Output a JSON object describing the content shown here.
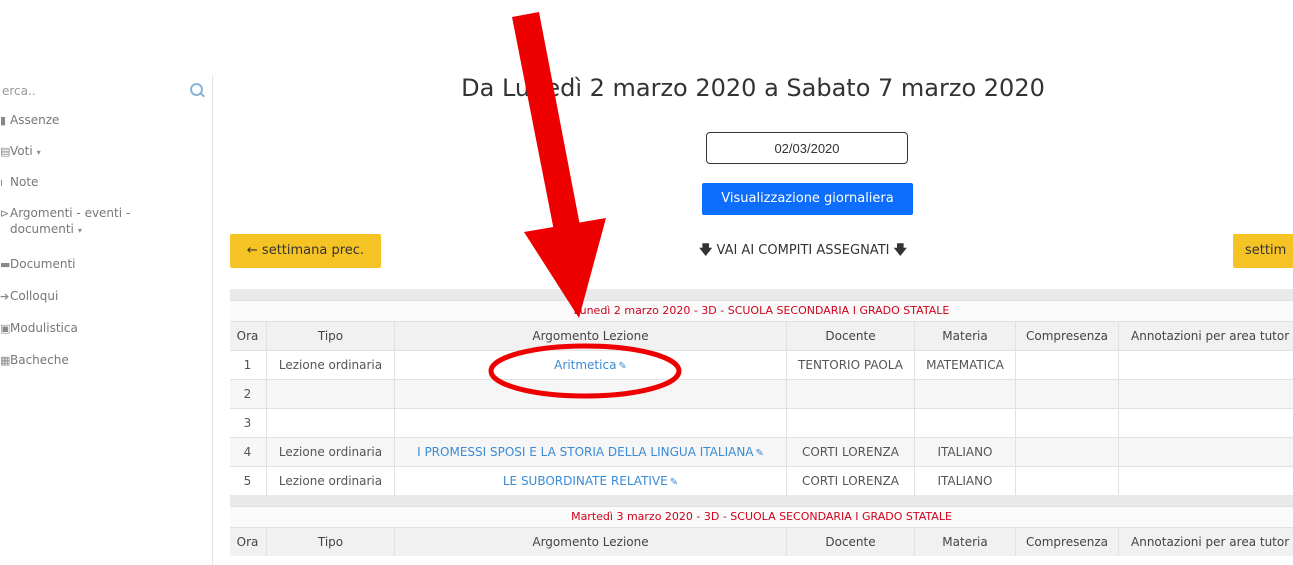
{
  "sidebar": {
    "search_placeholder": "erca..",
    "items": [
      {
        "label": "Assenze",
        "icon": "calendar-icon",
        "glyph": "▮"
      },
      {
        "label": "Voti",
        "icon": "grades-icon",
        "glyph": "▤",
        "dropdown": true
      },
      {
        "label": "Note",
        "icon": "note-icon",
        "glyph": "ı"
      },
      {
        "label": "Argomenti - eventi -",
        "label2": "documenti",
        "icon": "topics-icon",
        "glyph": "⊳",
        "dropdown": true
      },
      {
        "label": "Documenti",
        "icon": "documents-icon",
        "glyph": "▬"
      },
      {
        "label": "Colloqui",
        "icon": "meetings-icon",
        "glyph": "➔"
      },
      {
        "label": "Modulistica",
        "icon": "forms-icon",
        "glyph": "▣"
      },
      {
        "label": "Bacheche",
        "icon": "board-icon",
        "glyph": "▦"
      }
    ],
    "caret": "▾"
  },
  "header": {
    "title": "Da Lunedì 2 marzo 2020 a Sabato 7 marzo 2020"
  },
  "date_input": {
    "value": "02/03/2020"
  },
  "buttons": {
    "daily_view": "Visualizzazione giornaliera",
    "prev_week": "← settimana prec.",
    "next_week": "settim",
    "goto_tasks": "VAI AI COMPITI ASSEGNATI",
    "arrow_down": "🡇"
  },
  "columns": [
    "Ora",
    "Tipo",
    "Argomento Lezione",
    "Docente",
    "Materia",
    "Compresenza",
    "Annotazioni per area tutor"
  ],
  "days": [
    {
      "heading": "Lunedì 2 marzo 2020 - 3D - SCUOLA SECONDARIA I GRADO STATALE",
      "rows": [
        {
          "ora": "1",
          "tipo": "Lezione ordinaria",
          "argomento": "Aritmetica",
          "docente": "TENTORIO PAOLA",
          "materia": "MATEMATICA",
          "compresenza": "",
          "annotazioni": ""
        },
        {
          "ora": "2",
          "tipo": "",
          "argomento": "",
          "docente": "",
          "materia": "",
          "compresenza": "",
          "annotazioni": ""
        },
        {
          "ora": "3",
          "tipo": "",
          "argomento": "",
          "docente": "",
          "materia": "",
          "compresenza": "",
          "annotazioni": ""
        },
        {
          "ora": "4",
          "tipo": "Lezione ordinaria",
          "argomento": "I PROMESSI SPOSI E LA STORIA DELLA LINGUA ITALIANA",
          "docente": "CORTI LORENZA",
          "materia": "ITALIANO",
          "compresenza": "",
          "annotazioni": ""
        },
        {
          "ora": "5",
          "tipo": "Lezione ordinaria",
          "argomento": "LE SUBORDINATE RELATIVE",
          "docente": "CORTI LORENZA",
          "materia": "ITALIANO",
          "compresenza": "",
          "annotazioni": ""
        }
      ]
    },
    {
      "heading": "Martedì 3 marzo 2020 - 3D - SCUOLA SECONDARIA I GRADO STATALE",
      "rows": []
    }
  ],
  "annotation_colors": {
    "arrow": "#ee0000",
    "ellipse": "#ee0000"
  },
  "attachment_icon": "paperclip-icon",
  "attachment_glyph": "✎"
}
